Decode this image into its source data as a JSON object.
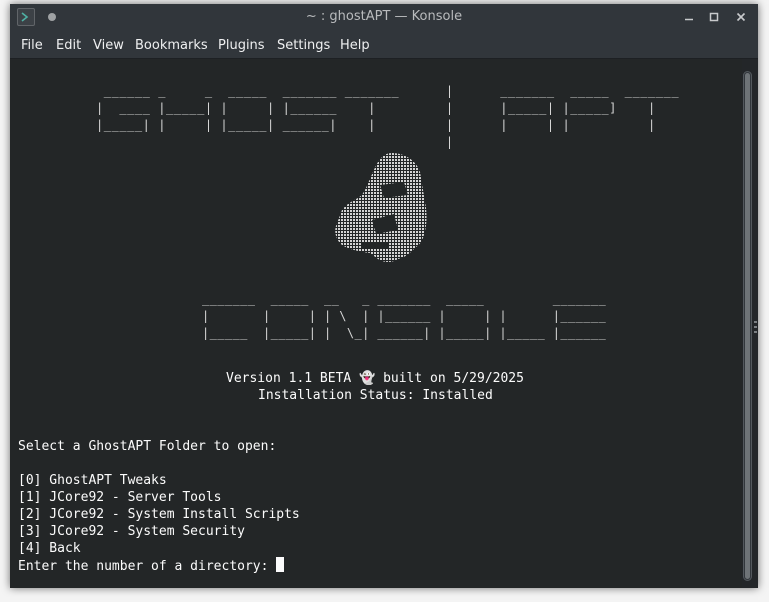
{
  "window": {
    "title": "~ : ghostAPT — Konsole",
    "icon": "konsole-terminal-icon",
    "controls": [
      "minimize",
      "maximize",
      "close"
    ]
  },
  "menu": [
    "File",
    "Edit",
    "View",
    "Bookmarks",
    "Plugins",
    "Settings",
    "Help"
  ],
  "banner": {
    "ghost_apt_art": " ______ _     _  _____  _______ _______      |      _______  _____  _______\n|  ____ |_____| |     | |______    |         |      |_____| |_____]    |   \n|_____| |     | |_____| ______|    |         |      |     | |          |   \n                                             |",
    "console_art": "_______  _____  __   _ _______  _____         _______\n|       |     | | \\  | |______ |     | |      |______\n|_____  |_____| |  \\_| ______| |_____| |_____ |______",
    "version_line": "Version 1.1 BETA 👻 built on 5/29/2025",
    "status_line": "Installation Status: Installed"
  },
  "prompt": {
    "heading": "Select a GhostAPT Folder to open:",
    "options": [
      "[0] GhostAPT Tweaks",
      "[1] JCore92 - Server Tools",
      "[2] JCore92 - System Install Scripts",
      "[3] JCore92 - System Security",
      "[4] Back"
    ],
    "input_prompt": "Enter the number of a directory: "
  },
  "colors": {
    "terminal_background": "#232627",
    "terminal_text": "#fcfcfc",
    "titlebar": "#31363b",
    "menu_text": "#eff0f1"
  }
}
